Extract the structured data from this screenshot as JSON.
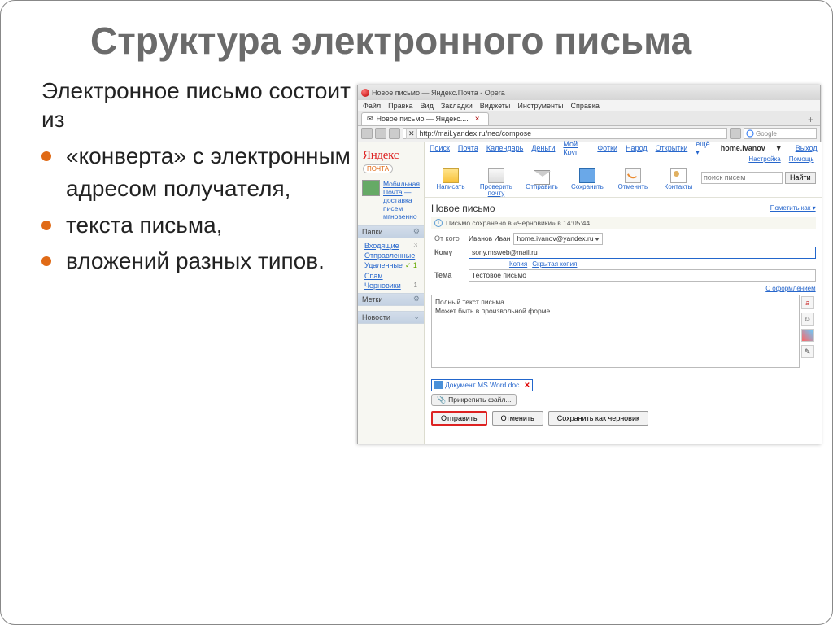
{
  "slide": {
    "title": "Структура электронного письма",
    "subtitle": "Электронное письмо состоит из",
    "bullets": [
      "«конверта» с электронным адресом получателя,",
      "текста письма,",
      "вложений разных типов."
    ]
  },
  "app": {
    "window_title": "Новое письмо — Яндекс.Почта - Opera",
    "menubar": [
      "Файл",
      "Правка",
      "Вид",
      "Закладки",
      "Виджеты",
      "Инструменты",
      "Справка"
    ],
    "tab": {
      "icon": "✉",
      "label": "Новое письмо — Яндекс...."
    },
    "url": "http://mail.yandex.ru/neo/compose",
    "search_placeholder": "Google"
  },
  "toplinks": {
    "links": [
      "Поиск",
      "Почта",
      "Календарь",
      "Деньги",
      "Мой Круг",
      "Фотки",
      "Народ",
      "Открытки"
    ],
    "more": "ещё ▾",
    "user": "home.ivanov",
    "tri": "▼",
    "exit": "Выход",
    "sub": [
      "Настройка",
      "Помощь"
    ]
  },
  "sidebar": {
    "brand": "Яндекс",
    "badge": "почта",
    "promo": {
      "link": "Мобильная Почта",
      "rest": " — доставка писем мгновенно"
    },
    "sections": {
      "folders": {
        "title": "Папки"
      },
      "labels": {
        "title": "Метки"
      },
      "news": {
        "title": "Новости"
      }
    },
    "folders": [
      {
        "label": "Входящие",
        "count": "3"
      },
      {
        "label": "Отправленные",
        "count": ""
      },
      {
        "label": "Удаленные",
        "count": "✓ 1"
      },
      {
        "label": "Спам",
        "count": ""
      },
      {
        "label": "Черновики",
        "count": "1"
      }
    ]
  },
  "toolbar": {
    "items": [
      {
        "label": "Написать"
      },
      {
        "label": "Проверить почту"
      },
      {
        "label": "Отправить"
      },
      {
        "label": "Сохранить"
      },
      {
        "label": "Отменить"
      },
      {
        "label": "Контакты"
      }
    ],
    "search_ph": "поиск писем",
    "search_btn": "Найти"
  },
  "compose": {
    "heading": "Новое письмо",
    "mark_as": "Пометить как ▾",
    "saved_info": "Письмо сохранено в «Черновики» в 14:05:44",
    "from_label": "От кого",
    "from_name": "Иванов Иван",
    "from_email": "home.ivanov@yandex.ru",
    "to_label": "Кому",
    "to_value": "sony.msweb@mail.ru",
    "cc": "Копия",
    "bcc": "Скрытая копия",
    "subj_label": "Тема",
    "subj_value": "Тестовое письмо",
    "design": "С оформлением",
    "body_line1": "Полный текст письма.",
    "body_line2": "Может быть в произвольной форме.",
    "attachment": "Документ MS Word.doc",
    "attach_x": "✕",
    "attach_btn": "Прикрепить файл...",
    "send": "Отправить",
    "cancel": "Отменить",
    "draft": "Сохранить как черновик"
  }
}
